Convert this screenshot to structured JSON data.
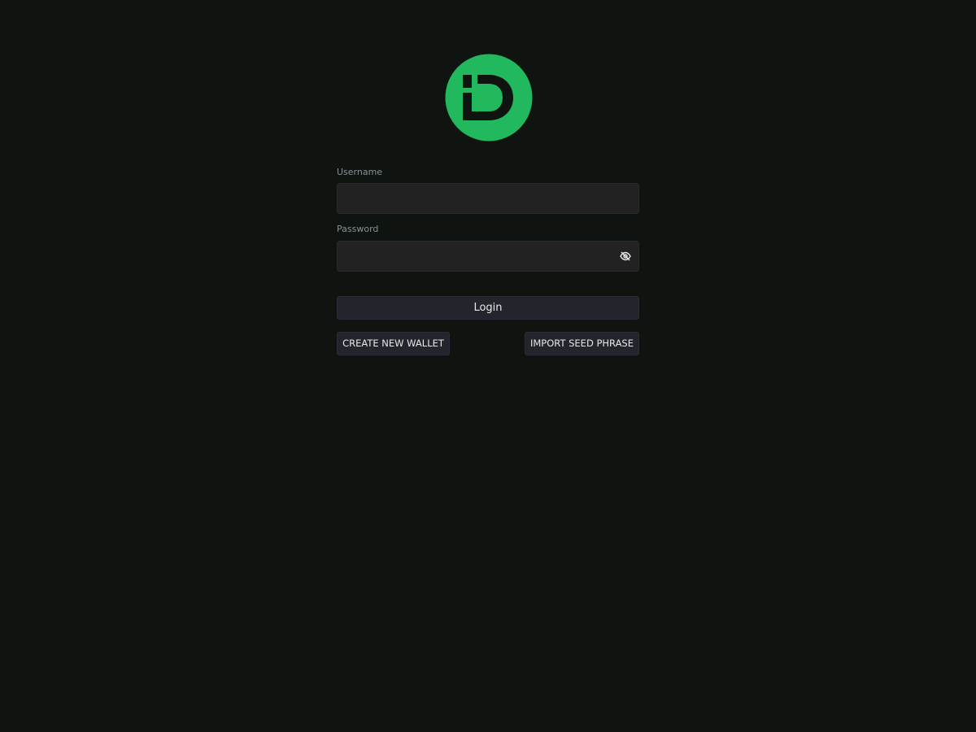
{
  "logo": {
    "icon": "brand-d-logo-icon",
    "circle_color": "#21b85e",
    "glyph_color": "#0f1410"
  },
  "login_form": {
    "username_label": "Username",
    "username_value": "",
    "password_label": "Password",
    "password_value": "",
    "password_toggle_icon": "eye-slash-icon",
    "login_label": "Login",
    "create_wallet_label": "CREATE NEW WALLET",
    "import_seed_label": "IMPORT SEED PHRASE"
  },
  "colors": {
    "background": "#0f1410",
    "input_background": "#222222",
    "button_background": "#22252c",
    "label_text": "#8a8f99",
    "button_text": "#e8e8e8"
  }
}
